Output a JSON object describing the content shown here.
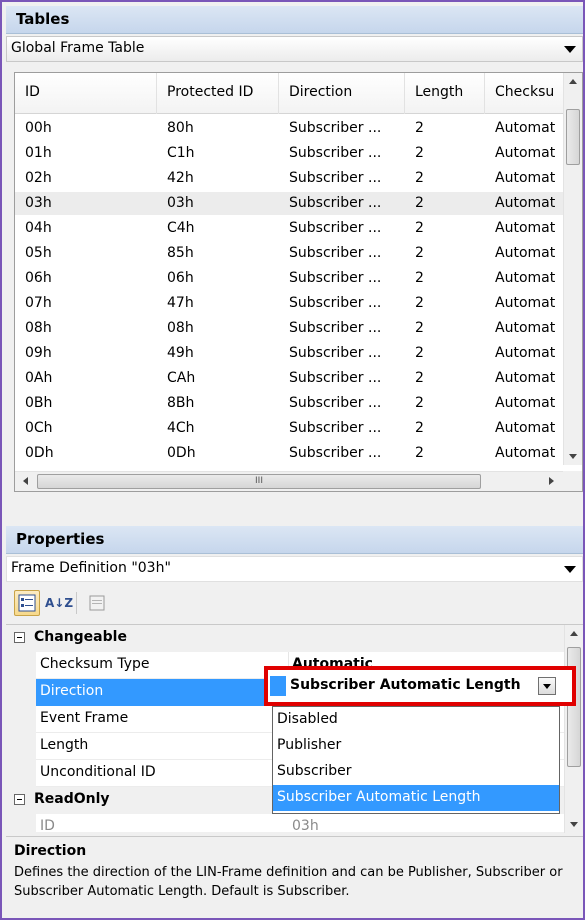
{
  "tables": {
    "header": "Tables",
    "selector_value": "Global Frame Table",
    "columns": [
      "ID",
      "Protected ID",
      "Direction",
      "Length",
      "Checksu"
    ],
    "rows": [
      [
        "00h",
        "80h",
        "Subscriber ...",
        "2",
        "Automat"
      ],
      [
        "01h",
        "C1h",
        "Subscriber ...",
        "2",
        "Automat"
      ],
      [
        "02h",
        "42h",
        "Subscriber ...",
        "2",
        "Automat"
      ],
      [
        "03h",
        "03h",
        "Subscriber ...",
        "2",
        "Automat"
      ],
      [
        "04h",
        "C4h",
        "Subscriber ...",
        "2",
        "Automat"
      ],
      [
        "05h",
        "85h",
        "Subscriber ...",
        "2",
        "Automat"
      ],
      [
        "06h",
        "06h",
        "Subscriber ...",
        "2",
        "Automat"
      ],
      [
        "07h",
        "47h",
        "Subscriber ...",
        "2",
        "Automat"
      ],
      [
        "08h",
        "08h",
        "Subscriber ...",
        "2",
        "Automat"
      ],
      [
        "09h",
        "49h",
        "Subscriber ...",
        "2",
        "Automat"
      ],
      [
        "0Ah",
        "CAh",
        "Subscriber ...",
        "2",
        "Automat"
      ],
      [
        "0Bh",
        "8Bh",
        "Subscriber ...",
        "2",
        "Automat"
      ],
      [
        "0Ch",
        "4Ch",
        "Subscriber ...",
        "2",
        "Automat"
      ],
      [
        "0Dh",
        "0Dh",
        "Subscriber ...",
        "2",
        "Automat"
      ]
    ],
    "selected_row": 3,
    "hscroll_grip": "III"
  },
  "properties": {
    "header": "Properties",
    "selector_value": "Frame Definition \"03h\"",
    "toolbar": {
      "categorized_icon": "categorized-icon",
      "alphabetical_label": "A↓Z",
      "property_pages_icon": "property-pages-icon"
    },
    "categories": [
      {
        "label": "Changeable",
        "items": [
          {
            "name": "Checksum Type",
            "value": "Automatic"
          },
          {
            "name": "Direction",
            "value": "Subscriber Automatic Length"
          },
          {
            "name": "Event Frame",
            "value": ""
          },
          {
            "name": "Length",
            "value": ""
          },
          {
            "name": "Unconditional ID",
            "value": ""
          }
        ]
      },
      {
        "label": "ReadOnly",
        "items": [
          {
            "name": "ID",
            "value": "03h"
          }
        ]
      }
    ],
    "dropdown_options": [
      "Disabled",
      "Publisher",
      "Subscriber",
      "Subscriber Automatic Length"
    ],
    "selected_option": 3,
    "description": {
      "title": "Direction",
      "text": "Defines the direction of the LIN-Frame definition and can be Publisher, Subscriber or Subscriber Automatic Length. Default is Subscriber."
    }
  },
  "colors": {
    "selection": "#3399ff",
    "highlight_box": "#e00000",
    "window_border": "#7a56b8"
  }
}
